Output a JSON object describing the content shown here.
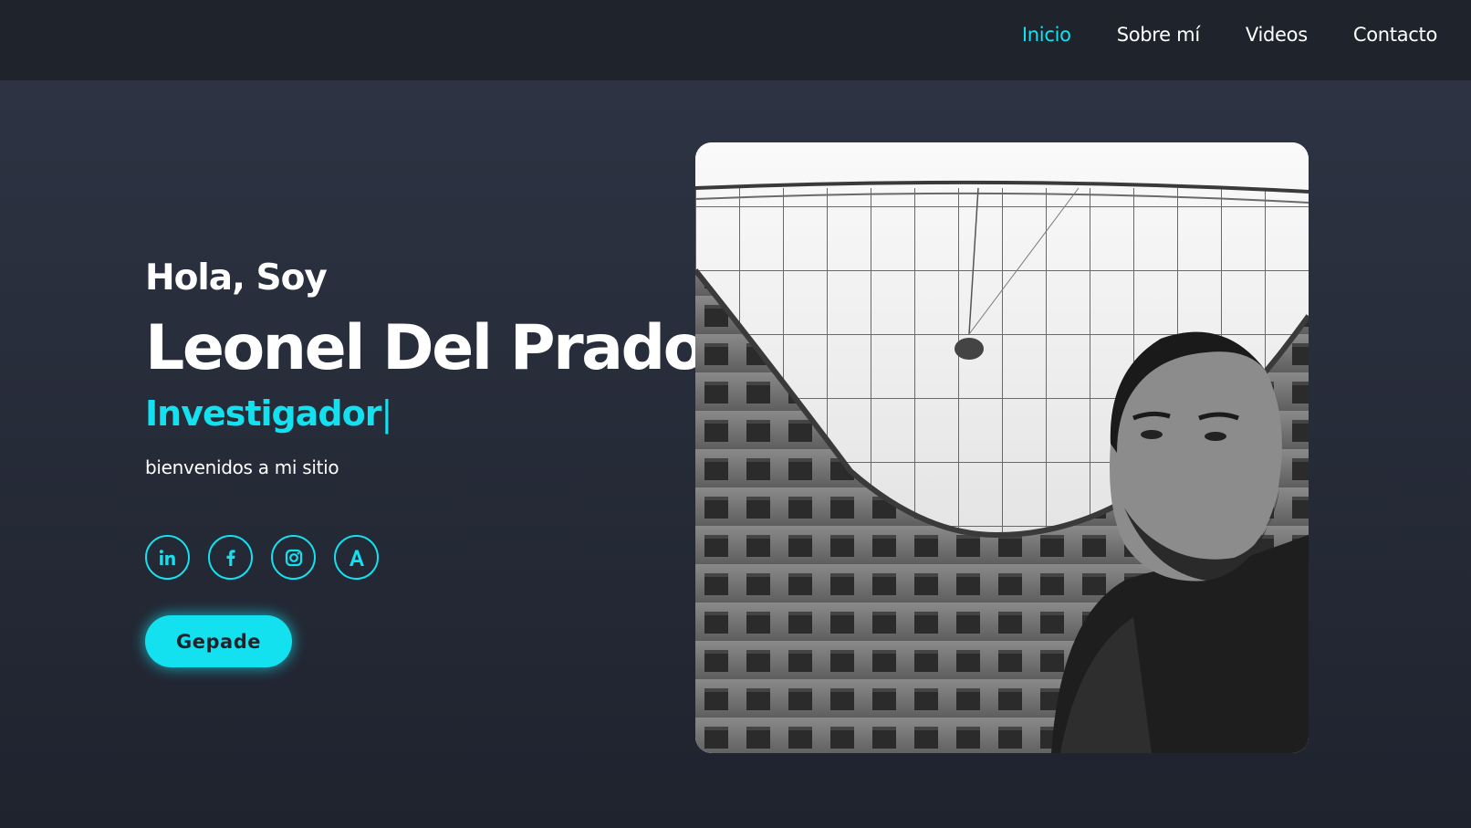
{
  "nav": {
    "items": [
      {
        "label": "Inicio",
        "active": true
      },
      {
        "label": "Sobre mí",
        "active": false
      },
      {
        "label": "Videos",
        "active": false
      },
      {
        "label": "Contacto",
        "active": false
      }
    ]
  },
  "hero": {
    "greeting": "Hola, Soy",
    "name": "Leonel Del Prado",
    "role": "Investigador",
    "cursor": "|",
    "welcome": "bienvenidos a mi sitio",
    "button_label": "Gepade"
  },
  "socials": [
    {
      "icon": "linkedin-icon",
      "glyph": "in"
    },
    {
      "icon": "facebook-icon",
      "glyph": "f"
    },
    {
      "icon": "instagram-icon",
      "glyph": ""
    },
    {
      "icon": "academia-icon",
      "glyph": "A"
    }
  ],
  "colors": {
    "accent": "#14e1f0",
    "topbar": "#1f232c",
    "background": "#2a2f3d",
    "text": "#ffffff"
  }
}
